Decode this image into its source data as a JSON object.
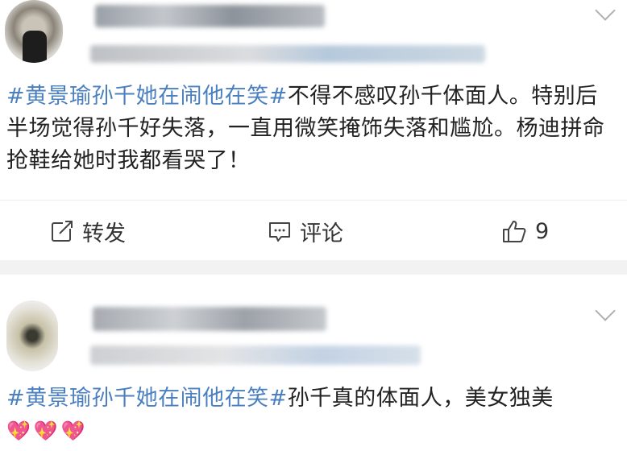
{
  "post1": {
    "hashtag": "#黄景瑜孙千她在闹他在笑#",
    "body": "不得不感叹孙千体面人。特别后半场觉得孙千好失落，一直用微笑掩饰失落和尴尬。杨迪拼命抢鞋给她时我都看哭了！",
    "actions": {
      "repost_label": "转发",
      "comment_label": "评论",
      "like_count": "9"
    }
  },
  "post2": {
    "hashtag": "#黄景瑜孙千她在闹他在笑#",
    "body": "孙千真的体面人，美女独美",
    "emoji": "💖💖💖"
  },
  "colors": {
    "hashtag": "#4a7fc0",
    "separator": "#f2f2f2",
    "text": "#222222"
  },
  "icons": [
    "chevron-down-icon",
    "repost-icon",
    "comment-icon",
    "thumbs-up-icon"
  ]
}
